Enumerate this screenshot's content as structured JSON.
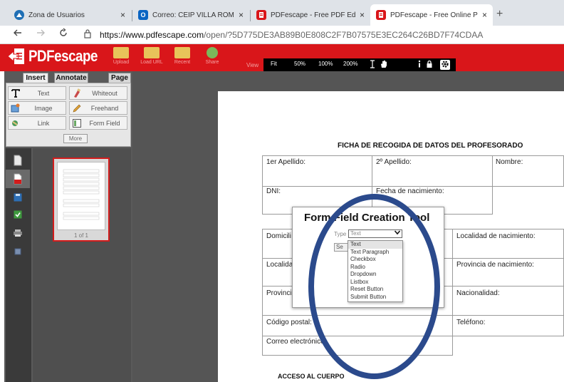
{
  "browser": {
    "tabs": [
      {
        "title": "Zona de Usuarios",
        "icon": "app-icon",
        "color": "#1f6fb5"
      },
      {
        "title": "Correo: CEIP VILLA ROMANA - C",
        "icon": "outlook-icon",
        "color": "#0a64c2"
      },
      {
        "title": "PDFescape - Free PDF Editor & F",
        "icon": "pdfescape-icon",
        "color": "#d9161a"
      },
      {
        "title": "PDFescape - Free Online PDF Ed",
        "icon": "pdfescape-icon",
        "color": "#d9161a"
      }
    ],
    "close_glyph": "×",
    "new_tab_glyph": "+",
    "url_host": "https://www.pdfescape.com",
    "url_path": "/open/?5D775DE3AB89B0E808C2F7B07575E3EC264C26BD7F74CDAA"
  },
  "app": {
    "logo_text": "PDFescape",
    "header_buttons": [
      "Upload",
      "Load URL",
      "Recent",
      "Share"
    ],
    "view_label": "View",
    "view_buttons": [
      "Fit",
      "50%",
      "100%",
      "200%"
    ],
    "brand_color": "#d9161a"
  },
  "left_panel": {
    "tabs": [
      "Insert",
      "Annotate",
      "Page"
    ],
    "tools": [
      {
        "label": "Text",
        "icon": "text-icon"
      },
      {
        "label": "Whiteout",
        "icon": "whiteout-icon"
      },
      {
        "label": "Image",
        "icon": "image-icon"
      },
      {
        "label": "Freehand",
        "icon": "pencil-icon"
      },
      {
        "label": "Link",
        "icon": "link-icon"
      },
      {
        "label": "Form Field",
        "icon": "form-field-icon"
      }
    ],
    "more_label": "More",
    "thumbnail_label": "1 of 1"
  },
  "document": {
    "form_title": "FICHA DE RECOGIDA DE DATOS DEL PROFESORADO",
    "fields": {
      "apellido1": "1er Apellido:",
      "apellido2": "2º Apellido:",
      "nombre": "Nombre:",
      "dni": "DNI:",
      "fecha_nac": "Fecha de nacimiento:",
      "domicilio": "Domicili",
      "localidad_nac": "Localidad de nacimiento:",
      "localidad": "Localida",
      "provincia_nac": "Provincia de nacimiento:",
      "provincia": "Provinci",
      "nacionalidad": "Nacionalidad:",
      "codigo_postal": "Código postal:",
      "telefono": "Teléfono:",
      "correo": "Correo electrónico:"
    },
    "section_heading": "ACCESO AL CUERPO"
  },
  "dialog": {
    "title": "Form Field Creation Tool",
    "type_label": "Type",
    "type_value": "Text",
    "select_button": "Se",
    "options": [
      "Text",
      "Text Paragraph",
      "Checkbox",
      "Radio",
      "Dropdown",
      "Listbox",
      "Reset Button",
      "Submit Button"
    ]
  },
  "annotation": {
    "ring_color": "#2b4a8c"
  }
}
